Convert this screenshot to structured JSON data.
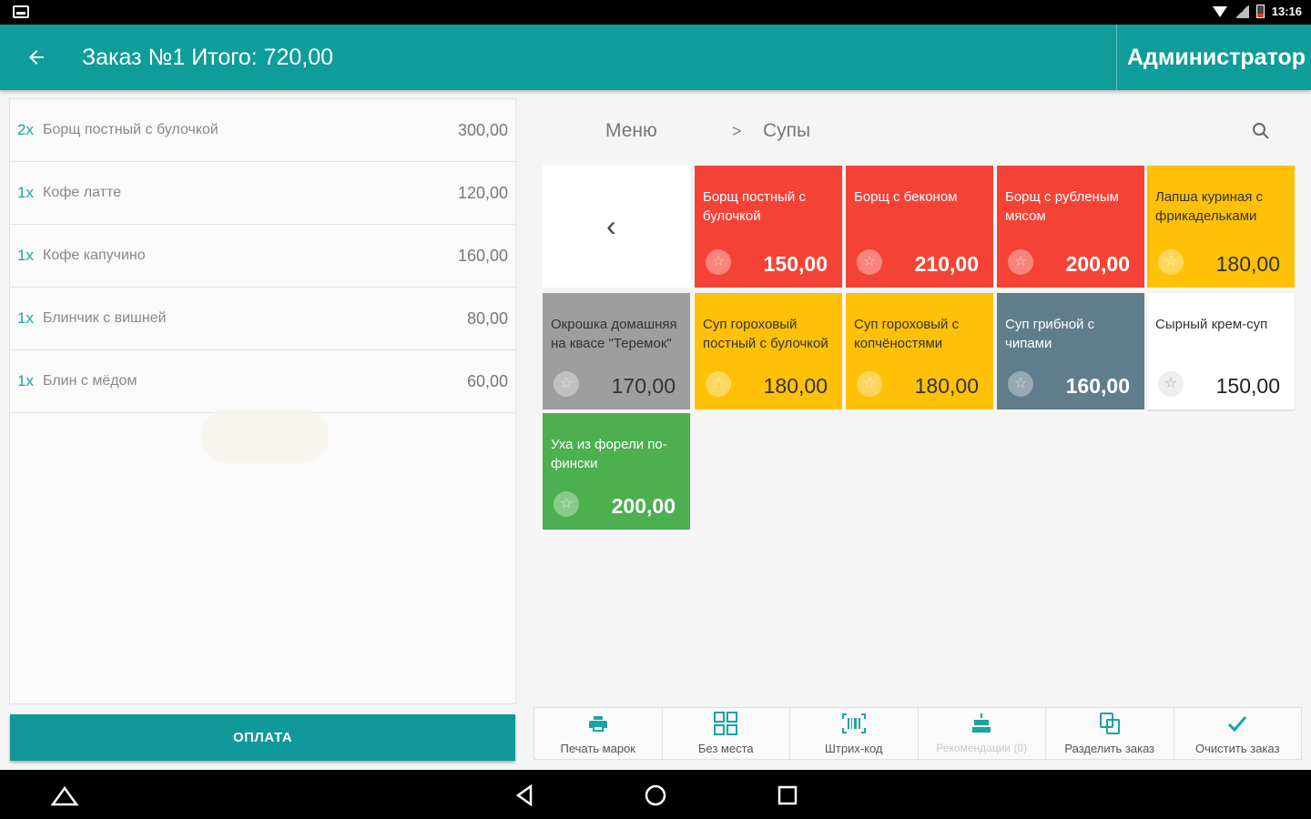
{
  "status_bar": {
    "time": "13:16"
  },
  "app_bar": {
    "back_icon": "arrow-left-icon",
    "title": "Заказ №1 Итого: 720,00",
    "user": "Администратор",
    "color": "#0f9d9a"
  },
  "order": {
    "items": [
      {
        "qty": "2x",
        "name": "Борщ постный с булочкой",
        "price": "300,00"
      },
      {
        "qty": "1x",
        "name": "Кофе латте",
        "price": "120,00"
      },
      {
        "qty": "1x",
        "name": "Кофе капучино",
        "price": "160,00"
      },
      {
        "qty": "1x",
        "name": "Блинчик с вишней",
        "price": "80,00"
      },
      {
        "qty": "1x",
        "name": "Блин с мёдом",
        "price": "60,00"
      }
    ],
    "pay_label": "ОПЛАТА"
  },
  "breadcrumb": {
    "root": "Меню",
    "separator": ">",
    "current": "Супы"
  },
  "tiles": [
    {
      "name": "Борщ постный с булочкой",
      "price": "150,00",
      "color": "#f44336"
    },
    {
      "name": "Борщ с беконом",
      "price": "210,00",
      "color": "#f44336"
    },
    {
      "name": "Борщ с рубленым мясом",
      "price": "200,00",
      "color": "#f44336"
    },
    {
      "name": "Лапша куриная с фрикадельками",
      "price": "180,00",
      "color": "#ffc107"
    },
    {
      "name": "Окрошка домашняя на квасе \"Теремок\"",
      "price": "170,00",
      "color": "#9e9e9e"
    },
    {
      "name": "Суп гороховый постный с булочкой",
      "price": "180,00",
      "color": "#ffc107"
    },
    {
      "name": "Суп гороховый с копчёностями",
      "price": "180,00",
      "color": "#ffc107"
    },
    {
      "name": "Суп грибной с чипами",
      "price": "160,00",
      "color": "#607d8b"
    },
    {
      "name": "Сырный крем-суп",
      "price": "150,00",
      "color": "#ffffff"
    },
    {
      "name": "Уха из форели по-фински",
      "price": "200,00",
      "color": "#4caf50"
    }
  ],
  "toolbar": [
    {
      "icon": "printer-icon",
      "label": "Печать марок"
    },
    {
      "icon": "grid-icon",
      "label": "Без места"
    },
    {
      "icon": "barcode-icon",
      "label": "Штрих-код"
    },
    {
      "icon": "cake-icon",
      "label": "Рекомендации (0)"
    },
    {
      "icon": "split-icon",
      "label": "Разделить заказ"
    },
    {
      "icon": "check-icon",
      "label": "Очистить заказ"
    }
  ],
  "nav": {
    "icons": [
      "home-triangle-icon",
      "back-triangle-icon",
      "home-circle-icon",
      "recents-square-icon"
    ]
  }
}
